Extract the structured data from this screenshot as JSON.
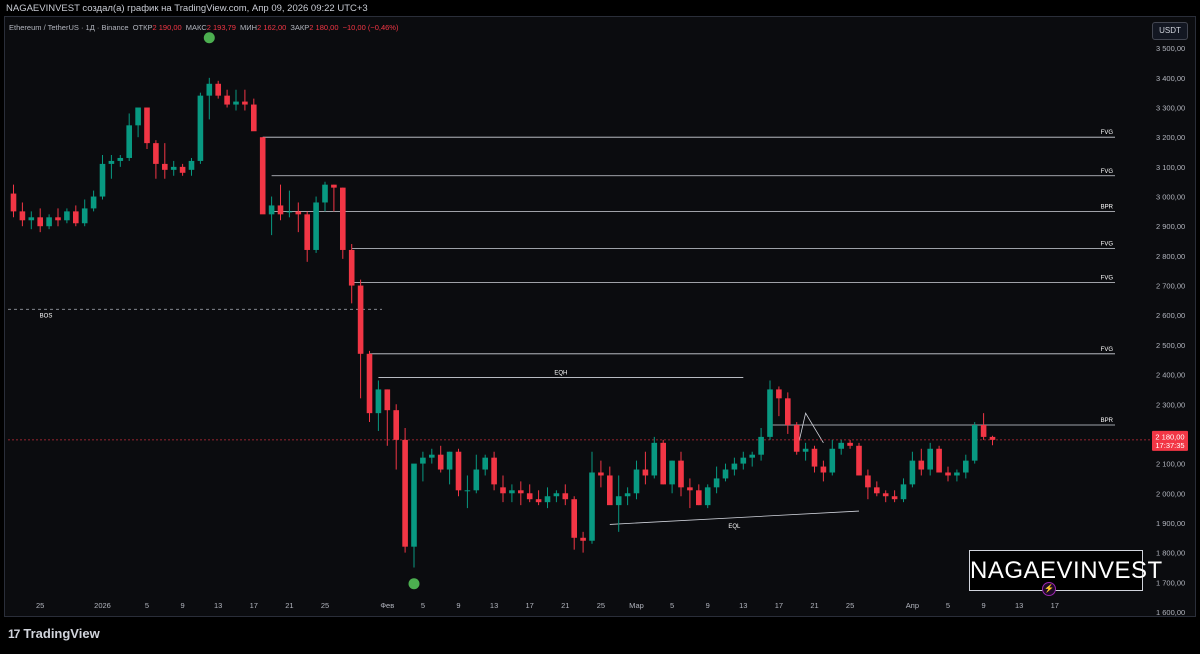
{
  "header": {
    "caption": "NAGAEVINVEST создал(а) график на TradingView.com, Апр 09, 2026 09:22 UTC+3"
  },
  "legend": {
    "symbol": "Ethereum / TetherUS · 1Д · Binance",
    "open_label": "ОТКР",
    "open_value": "2 190,00",
    "high_label": "МАКС",
    "high_value": "2 193,79",
    "low_label": "МИН",
    "low_value": "2 162,00",
    "close_label": "ЗАКР",
    "close_value": "2 180,00",
    "change_value": "−10,00 (−0,46%)"
  },
  "currency_button": "USDT",
  "watermark": "NAGAEVINVEST",
  "footer_brand": "TradingView",
  "footer_mark": "17",
  "colors": {
    "up": "#089981",
    "down": "#f23645",
    "level_line": "#d1d4dc",
    "marker": "#4caf50",
    "price_tag": "#f23645"
  },
  "chart_data": {
    "type": "candlestick",
    "ylim": [
      1550,
      3600
    ],
    "y_ticks": [
      3500,
      3400,
      3300,
      3200,
      3100,
      3000,
      2900,
      2800,
      2700,
      2600,
      2500,
      2400,
      2300,
      2200,
      2100,
      2000,
      1900,
      1800,
      1700,
      1600
    ],
    "y_tick_labels": [
      "3 500,00",
      "3 400,00",
      "3 300,00",
      "3 200,00",
      "3 100,00",
      "3 000,00",
      "2 900,00",
      "2 800,00",
      "2 700,00",
      "2 600,00",
      "2 500,00",
      "2 400,00",
      "2 300,00",
      "2 200,00",
      "2 100,00",
      "2 000,00",
      "1 900,00",
      "1 800,00",
      "1 700,00",
      "1 600,00"
    ],
    "x_ticks": [
      {
        "bar": 3,
        "label": "25"
      },
      {
        "bar": 10,
        "label": "2026"
      },
      {
        "bar": 15,
        "label": "5"
      },
      {
        "bar": 19,
        "label": "9"
      },
      {
        "bar": 23,
        "label": "13"
      },
      {
        "bar": 27,
        "label": "17"
      },
      {
        "bar": 31,
        "label": "21"
      },
      {
        "bar": 35,
        "label": "25"
      },
      {
        "bar": 42,
        "label": "Фев"
      },
      {
        "bar": 46,
        "label": "5"
      },
      {
        "bar": 50,
        "label": "9"
      },
      {
        "bar": 54,
        "label": "13"
      },
      {
        "bar": 58,
        "label": "17"
      },
      {
        "bar": 62,
        "label": "21"
      },
      {
        "bar": 66,
        "label": "25"
      },
      {
        "bar": 70,
        "label": "Мар"
      },
      {
        "bar": 74,
        "label": "5"
      },
      {
        "bar": 78,
        "label": "9"
      },
      {
        "bar": 82,
        "label": "13"
      },
      {
        "bar": 86,
        "label": "17"
      },
      {
        "bar": 90,
        "label": "21"
      },
      {
        "bar": 94,
        "label": "25"
      },
      {
        "bar": 101,
        "label": "Апр"
      },
      {
        "bar": 105,
        "label": "5"
      },
      {
        "bar": 109,
        "label": "9"
      },
      {
        "bar": 113,
        "label": "13"
      },
      {
        "bar": 117,
        "label": "17"
      }
    ],
    "candles": [
      [
        3010,
        3040,
        2930,
        2950
      ],
      [
        2950,
        2980,
        2900,
        2920
      ],
      [
        2920,
        2950,
        2890,
        2930
      ],
      [
        2930,
        2960,
        2880,
        2900
      ],
      [
        2900,
        2940,
        2890,
        2930
      ],
      [
        2930,
        2960,
        2900,
        2920
      ],
      [
        2920,
        2960,
        2910,
        2950
      ],
      [
        2950,
        2970,
        2900,
        2910
      ],
      [
        2910,
        2990,
        2900,
        2960
      ],
      [
        2960,
        3020,
        2950,
        3000
      ],
      [
        3000,
        3140,
        2990,
        3110
      ],
      [
        3110,
        3140,
        3060,
        3120
      ],
      [
        3120,
        3140,
        3100,
        3130
      ],
      [
        3130,
        3280,
        3120,
        3240
      ],
      [
        3240,
        3290,
        3200,
        3300
      ],
      [
        3300,
        3300,
        3160,
        3180
      ],
      [
        3180,
        3190,
        3060,
        3110
      ],
      [
        3110,
        3180,
        3060,
        3090
      ],
      [
        3090,
        3120,
        3070,
        3100
      ],
      [
        3100,
        3110,
        3070,
        3080
      ],
      [
        3090,
        3130,
        3070,
        3120
      ],
      [
        3120,
        3350,
        3110,
        3340
      ],
      [
        3340,
        3400,
        3260,
        3380
      ],
      [
        3380,
        3390,
        3330,
        3340
      ],
      [
        3340,
        3360,
        3300,
        3310
      ],
      [
        3310,
        3360,
        3290,
        3320
      ],
      [
        3320,
        3360,
        3290,
        3310
      ],
      [
        3310,
        3330,
        3260,
        3220
      ],
      [
        3200,
        3200,
        3140,
        2940
      ],
      [
        2940,
        3000,
        2870,
        2970
      ],
      [
        2970,
        3040,
        2920,
        2940
      ],
      [
        2950,
        3020,
        2930,
        2950
      ],
      [
        2950,
        2980,
        2880,
        2940
      ],
      [
        2940,
        2950,
        2780,
        2820
      ],
      [
        2820,
        3000,
        2810,
        2980
      ],
      [
        2980,
        3050,
        2950,
        3040
      ],
      [
        3040,
        3040,
        2950,
        3030
      ],
      [
        3030,
        3030,
        2790,
        2820
      ],
      [
        2820,
        2840,
        2640,
        2700
      ],
      [
        2700,
        2720,
        2320,
        2470
      ],
      [
        2470,
        2480,
        2240,
        2270
      ],
      [
        2270,
        2380,
        2210,
        2350
      ],
      [
        2350,
        2350,
        2160,
        2280
      ],
      [
        2280,
        2300,
        2080,
        2180
      ],
      [
        2180,
        2220,
        1800,
        1820
      ],
      [
        1820,
        1950,
        1750,
        2100
      ],
      [
        2100,
        2140,
        2040,
        2120
      ],
      [
        2120,
        2150,
        2100,
        2130
      ],
      [
        2130,
        2160,
        2070,
        2080
      ],
      [
        2080,
        2140,
        2030,
        2140
      ],
      [
        2140,
        2150,
        1990,
        2010
      ],
      [
        2010,
        2060,
        1950,
        2010
      ],
      [
        2010,
        2130,
        2000,
        2080
      ],
      [
        2080,
        2130,
        2060,
        2120
      ],
      [
        2120,
        2140,
        2010,
        2030
      ],
      [
        2020,
        2060,
        1970,
        2000
      ],
      [
        2000,
        2030,
        1970,
        2010
      ],
      [
        2010,
        2040,
        1960,
        2000
      ],
      [
        2000,
        2030,
        1970,
        1980
      ],
      [
        1980,
        2010,
        1960,
        1970
      ],
      [
        1970,
        2020,
        1950,
        1990
      ],
      [
        1990,
        2010,
        1970,
        2000
      ],
      [
        2000,
        2030,
        1960,
        1980
      ],
      [
        1980,
        1990,
        1810,
        1850
      ],
      [
        1850,
        1870,
        1800,
        1840
      ],
      [
        1840,
        2140,
        1830,
        2070
      ],
      [
        2070,
        2110,
        2020,
        2060
      ],
      [
        2060,
        2090,
        1970,
        1960
      ],
      [
        1960,
        2060,
        1870,
        1990
      ],
      [
        1990,
        2020,
        1960,
        2000
      ],
      [
        2000,
        2110,
        1980,
        2080
      ],
      [
        2080,
        2140,
        2030,
        2060
      ],
      [
        2060,
        2190,
        2050,
        2170
      ],
      [
        2170,
        2180,
        2030,
        2030
      ],
      [
        2030,
        2110,
        2000,
        2110
      ],
      [
        2110,
        2140,
        1990,
        2020
      ],
      [
        2020,
        2050,
        1950,
        2010
      ],
      [
        2010,
        2030,
        1960,
        1960
      ],
      [
        1960,
        2030,
        1950,
        2020
      ],
      [
        2020,
        2090,
        2000,
        2050
      ],
      [
        2050,
        2100,
        2040,
        2080
      ],
      [
        2080,
        2120,
        2060,
        2100
      ],
      [
        2100,
        2140,
        2080,
        2120
      ],
      [
        2120,
        2140,
        2090,
        2130
      ],
      [
        2130,
        2220,
        2110,
        2190
      ],
      [
        2190,
        2380,
        2180,
        2350
      ],
      [
        2350,
        2360,
        2260,
        2320
      ],
      [
        2320,
        2340,
        2200,
        2230
      ],
      [
        2230,
        2240,
        2130,
        2140
      ],
      [
        2140,
        2170,
        2110,
        2150
      ],
      [
        2150,
        2160,
        2070,
        2090
      ],
      [
        2090,
        2110,
        2040,
        2070
      ],
      [
        2070,
        2180,
        2060,
        2150
      ],
      [
        2150,
        2180,
        2130,
        2170
      ],
      [
        2170,
        2180,
        2150,
        2160
      ],
      [
        2160,
        2170,
        2060,
        2060
      ],
      [
        2060,
        2080,
        1980,
        2020
      ],
      [
        2020,
        2040,
        1990,
        2000
      ],
      [
        2000,
        2010,
        1970,
        1990
      ],
      [
        1990,
        2010,
        1970,
        1980
      ],
      [
        1980,
        2050,
        1970,
        2030
      ],
      [
        2030,
        2140,
        2020,
        2110
      ],
      [
        2110,
        2150,
        2060,
        2080
      ],
      [
        2080,
        2170,
        2060,
        2150
      ],
      [
        2150,
        2160,
        2070,
        2070
      ],
      [
        2070,
        2090,
        2040,
        2060
      ],
      [
        2060,
        2080,
        2040,
        2070
      ],
      [
        2070,
        2130,
        2050,
        2110
      ],
      [
        2110,
        2240,
        2100,
        2230
      ],
      [
        2230,
        2270,
        2180,
        2190
      ],
      [
        2190,
        2194,
        2162,
        2180
      ]
    ],
    "levels": [
      {
        "label": "FVG",
        "price": 3200,
        "from_bar": 28
      },
      {
        "label": "FVG",
        "price": 3070,
        "from_bar": 29
      },
      {
        "label": "BPR",
        "price": 2950,
        "from_bar": 29
      },
      {
        "label": "FVG",
        "price": 2825,
        "from_bar": 38
      },
      {
        "label": "FVG",
        "price": 2710,
        "from_bar": 38
      },
      {
        "label": "FVG",
        "price": 2470,
        "from_bar": 40
      },
      {
        "label": "BPR",
        "price": 2230,
        "from_bar": 85
      }
    ],
    "bos": {
      "label": "BOS",
      "price": 2620
    },
    "eqh": {
      "label": "EQH",
      "price": 2390,
      "from_bar": 41,
      "to_bar": 82
    },
    "eql": {
      "label": "EQL",
      "from_bar": 67,
      "from_price": 1895,
      "to_bar": 95,
      "to_price": 1940
    },
    "zigzag": [
      {
        "bar": 88,
        "price": 2140
      },
      {
        "bar": 89,
        "price": 2270
      },
      {
        "bar": 91,
        "price": 2170
      }
    ],
    "markers": [
      {
        "bar": 22,
        "price": 3535
      },
      {
        "bar": 45,
        "price": 1695
      }
    ],
    "current_price": {
      "price": 2180,
      "label": "2 180,00",
      "timer": "17:37:35"
    }
  }
}
